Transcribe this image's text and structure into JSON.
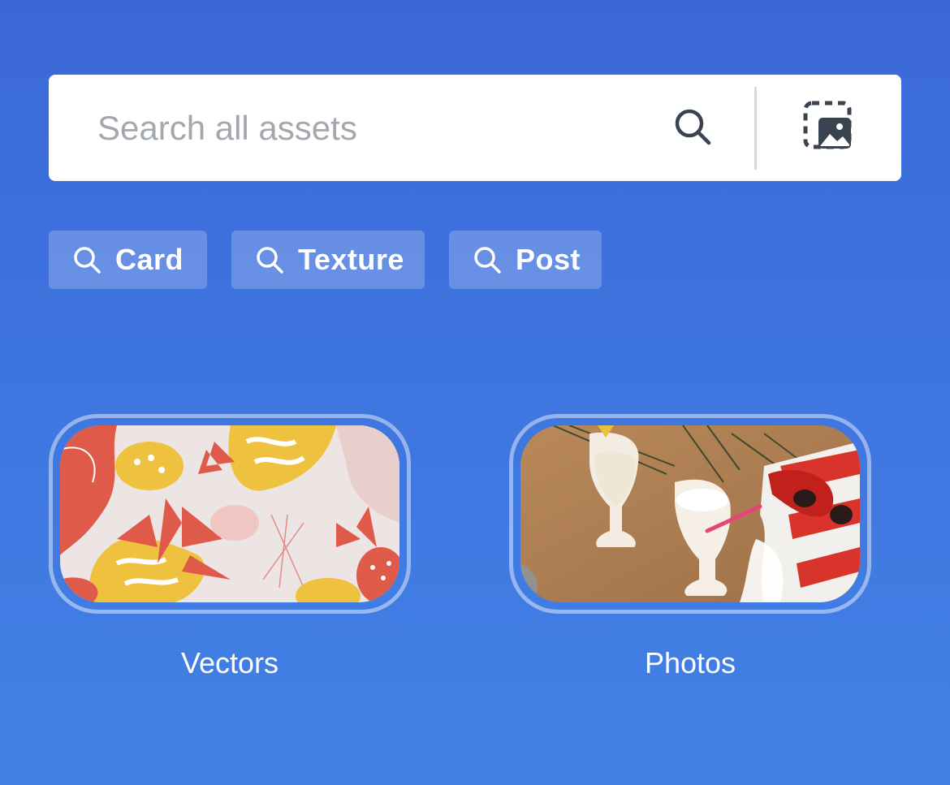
{
  "search": {
    "placeholder": "Search all assets",
    "value": ""
  },
  "icons": {
    "search": "search-icon",
    "image_search": "image-search-icon",
    "chip_search": "search-icon"
  },
  "suggestions": [
    {
      "label": "Card"
    },
    {
      "label": "Texture"
    },
    {
      "label": "Post"
    }
  ],
  "categories": [
    {
      "label": "Vectors"
    },
    {
      "label": "Photos"
    }
  ],
  "colors": {
    "background_top": "#3b68d8",
    "background_bottom": "#4282e6",
    "icon_dark": "#3a4450"
  }
}
